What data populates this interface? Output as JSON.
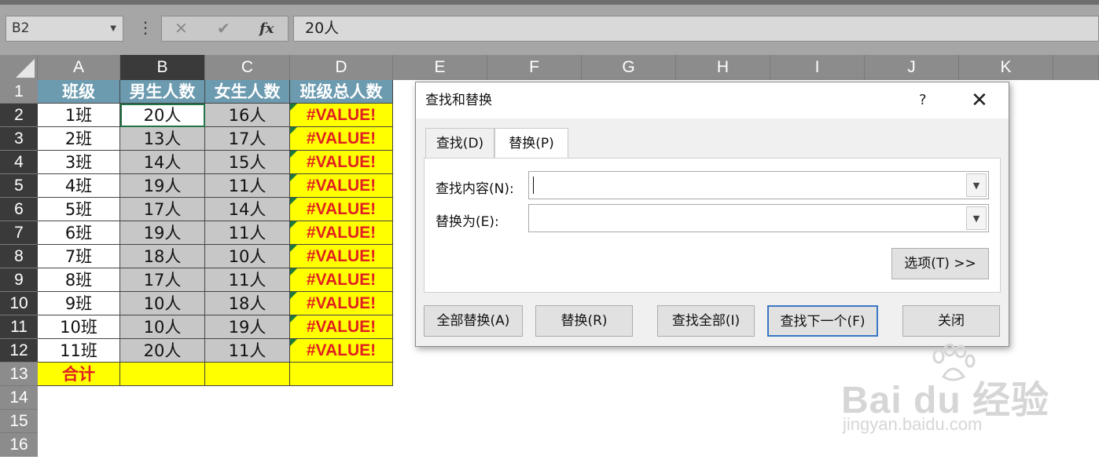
{
  "formula_bar": {
    "name_box": "B2",
    "formula": "20人",
    "cancel_icon": "✕",
    "enter_icon": "✔",
    "fx_label": "fx"
  },
  "columns": [
    "A",
    "B",
    "C",
    "D",
    "E",
    "F",
    "G",
    "H",
    "I",
    "J",
    "K"
  ],
  "rows": [
    "1",
    "2",
    "3",
    "4",
    "5",
    "6",
    "7",
    "8",
    "9",
    "10",
    "11",
    "12",
    "13",
    "14",
    "15",
    "16"
  ],
  "table": {
    "headers": [
      "班级",
      "男生人数",
      "女生人数",
      "班级总人数"
    ],
    "data": [
      [
        "1班",
        "20人",
        "16人",
        "#VALUE!"
      ],
      [
        "2班",
        "13人",
        "17人",
        "#VALUE!"
      ],
      [
        "3班",
        "14人",
        "15人",
        "#VALUE!"
      ],
      [
        "4班",
        "19人",
        "11人",
        "#VALUE!"
      ],
      [
        "5班",
        "17人",
        "14人",
        "#VALUE!"
      ],
      [
        "6班",
        "19人",
        "11人",
        "#VALUE!"
      ],
      [
        "7班",
        "18人",
        "10人",
        "#VALUE!"
      ],
      [
        "8班",
        "17人",
        "11人",
        "#VALUE!"
      ],
      [
        "9班",
        "10人",
        "18人",
        "#VALUE!"
      ],
      [
        "10班",
        "10人",
        "19人",
        "#VALUE!"
      ],
      [
        "11班",
        "20人",
        "11人",
        "#VALUE!"
      ]
    ],
    "total_label": "合计"
  },
  "dialog": {
    "title": "查找和替换",
    "help": "?",
    "close": "✕",
    "tab_find": "查找(D)",
    "tab_replace": "替换(P)",
    "find_label": "查找内容(N):",
    "find_value": "",
    "replace_label": "替换为(E):",
    "replace_value": "",
    "options_button": "选项(T) >>",
    "replace_all_button": "全部替换(A)",
    "replace_button": "替换(R)",
    "find_all_button": "查找全部(I)",
    "find_next_button": "查找下一个(F)",
    "close_button": "关闭"
  },
  "watermark": {
    "brand": "Bai du 经验",
    "url": "jingyan.baidu.com"
  }
}
